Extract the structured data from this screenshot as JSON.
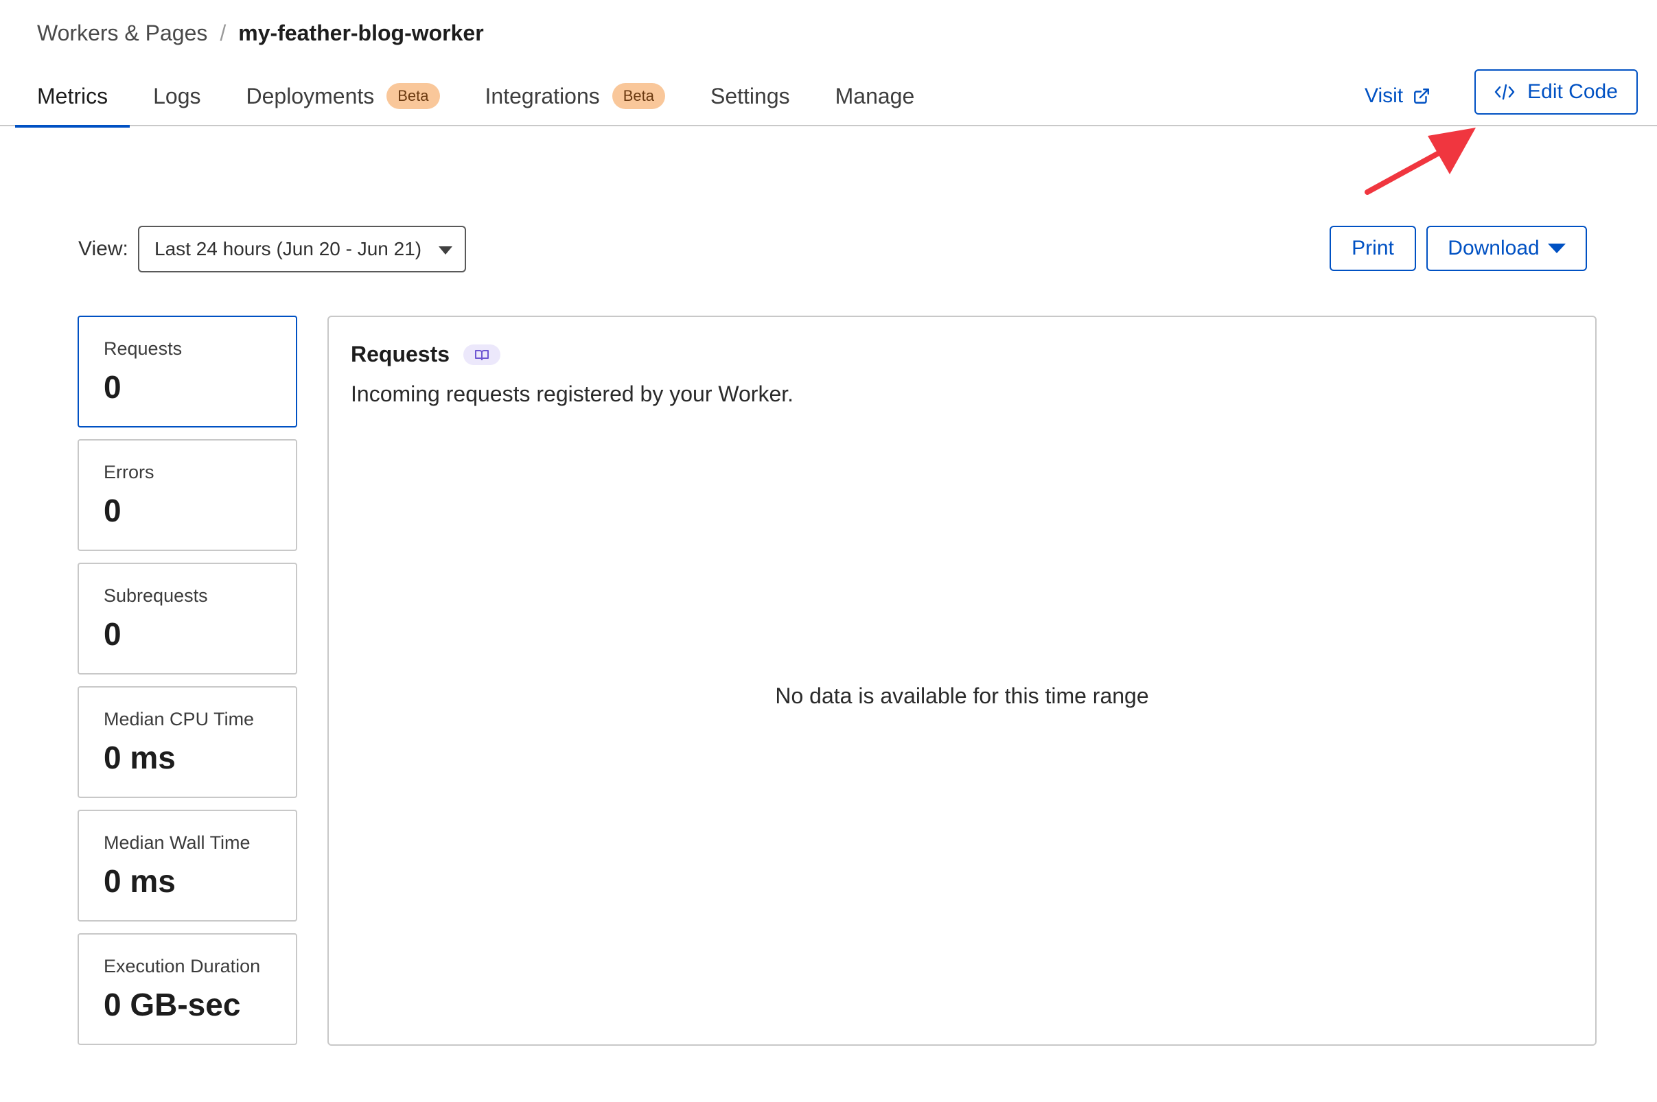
{
  "breadcrumb": {
    "parent": "Workers & Pages",
    "separator": "/",
    "current": "my-feather-blog-worker"
  },
  "tabs": [
    {
      "label": "Metrics",
      "active": true
    },
    {
      "label": "Logs"
    },
    {
      "label": "Deployments",
      "badge": "Beta"
    },
    {
      "label": "Integrations",
      "badge": "Beta"
    },
    {
      "label": "Settings"
    },
    {
      "label": "Manage"
    }
  ],
  "header_actions": {
    "visit_label": "Visit",
    "visit_icon": "external-link-icon",
    "edit_code_label": "Edit Code",
    "edit_code_icon": "code-icon"
  },
  "view": {
    "label": "View:",
    "selected": "Last 24 hours (Jun 20 - Jun 21)"
  },
  "toolbar": {
    "print_label": "Print",
    "download_label": "Download"
  },
  "metrics": [
    {
      "label": "Requests",
      "value": "0"
    },
    {
      "label": "Errors",
      "value": "0"
    },
    {
      "label": "Subrequests",
      "value": "0"
    },
    {
      "label": "Median CPU Time",
      "value": "0 ms"
    },
    {
      "label": "Median Wall Time",
      "value": "0 ms"
    },
    {
      "label": "Execution Duration",
      "value": "0 GB-sec"
    }
  ],
  "panel": {
    "title": "Requests",
    "doc_icon": "book-icon",
    "description": "Incoming requests registered by your Worker.",
    "empty_message": "No data is available for this time range"
  },
  "colors": {
    "accent": "#0051c3",
    "badge_bg": "#f9c79a",
    "annotation": "#f0363f"
  }
}
